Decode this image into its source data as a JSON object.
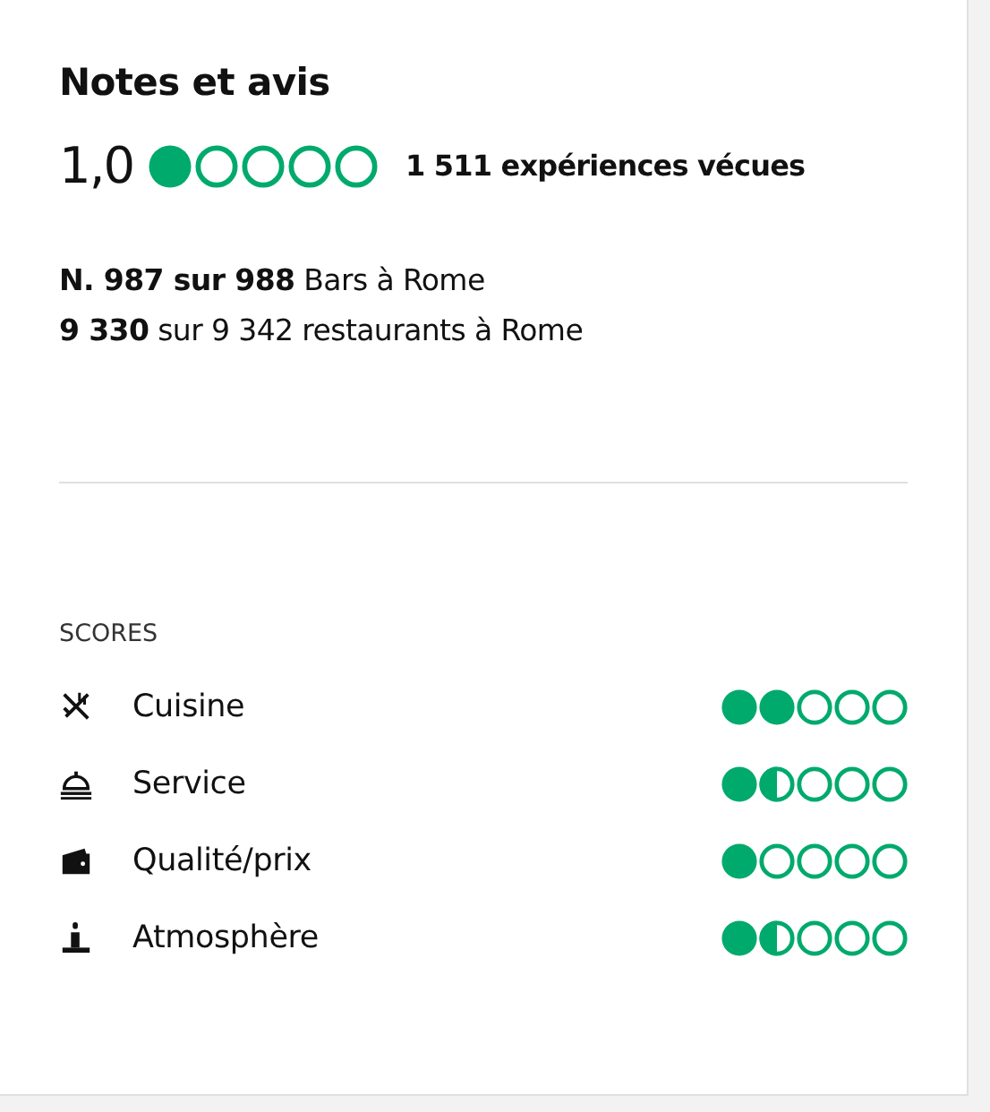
{
  "title": "Notes et avis",
  "rating": {
    "value": "1,0",
    "stars": 1,
    "reviews": "1 511 expériences vécues"
  },
  "rankings": [
    "**N. 987 sur 988** Bars à Rome",
    "**9 330** sur 9 342 restaurants à Rome"
  ],
  "scores": {
    "heading": "SCORES",
    "items": [
      {
        "label": "Cuisine",
        "stars": 2
      },
      {
        "label": "Service",
        "stars": 1.5
      },
      {
        "label": "Qualité/prix",
        "stars": 1
      },
      {
        "label": "Atmosphère",
        "stars": 1.5
      }
    ]
  }
}
